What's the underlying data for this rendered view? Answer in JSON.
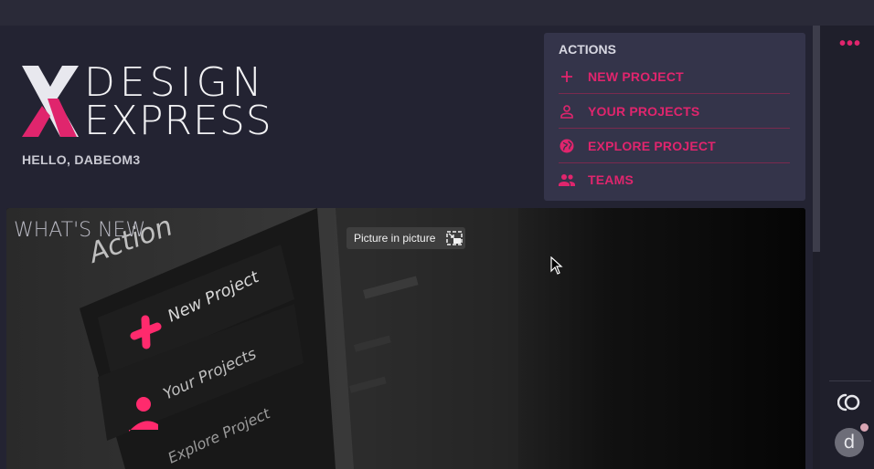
{
  "header": {
    "brand_line1": "DESIGN",
    "brand_line2": "EXPRESS",
    "greeting": "HELLO, DABEOM3"
  },
  "actions": {
    "title": "ACTIONS",
    "items": [
      {
        "label": "NEW PROJECT",
        "icon": "plus-icon"
      },
      {
        "label": "YOUR PROJECTS",
        "icon": "person-icon"
      },
      {
        "label": "EXPLORE PROJECT",
        "icon": "globe-icon"
      },
      {
        "label": "TEAMS",
        "icon": "people-icon"
      }
    ]
  },
  "news": {
    "title": "WHAT'S NEW",
    "pip_label": "Picture in picture"
  },
  "rail": {
    "menu_icon": "more-dots-icon",
    "avatar_letter": "d"
  },
  "colors": {
    "accent": "#e0256d",
    "background": "#232332",
    "panel": "#34344a"
  }
}
